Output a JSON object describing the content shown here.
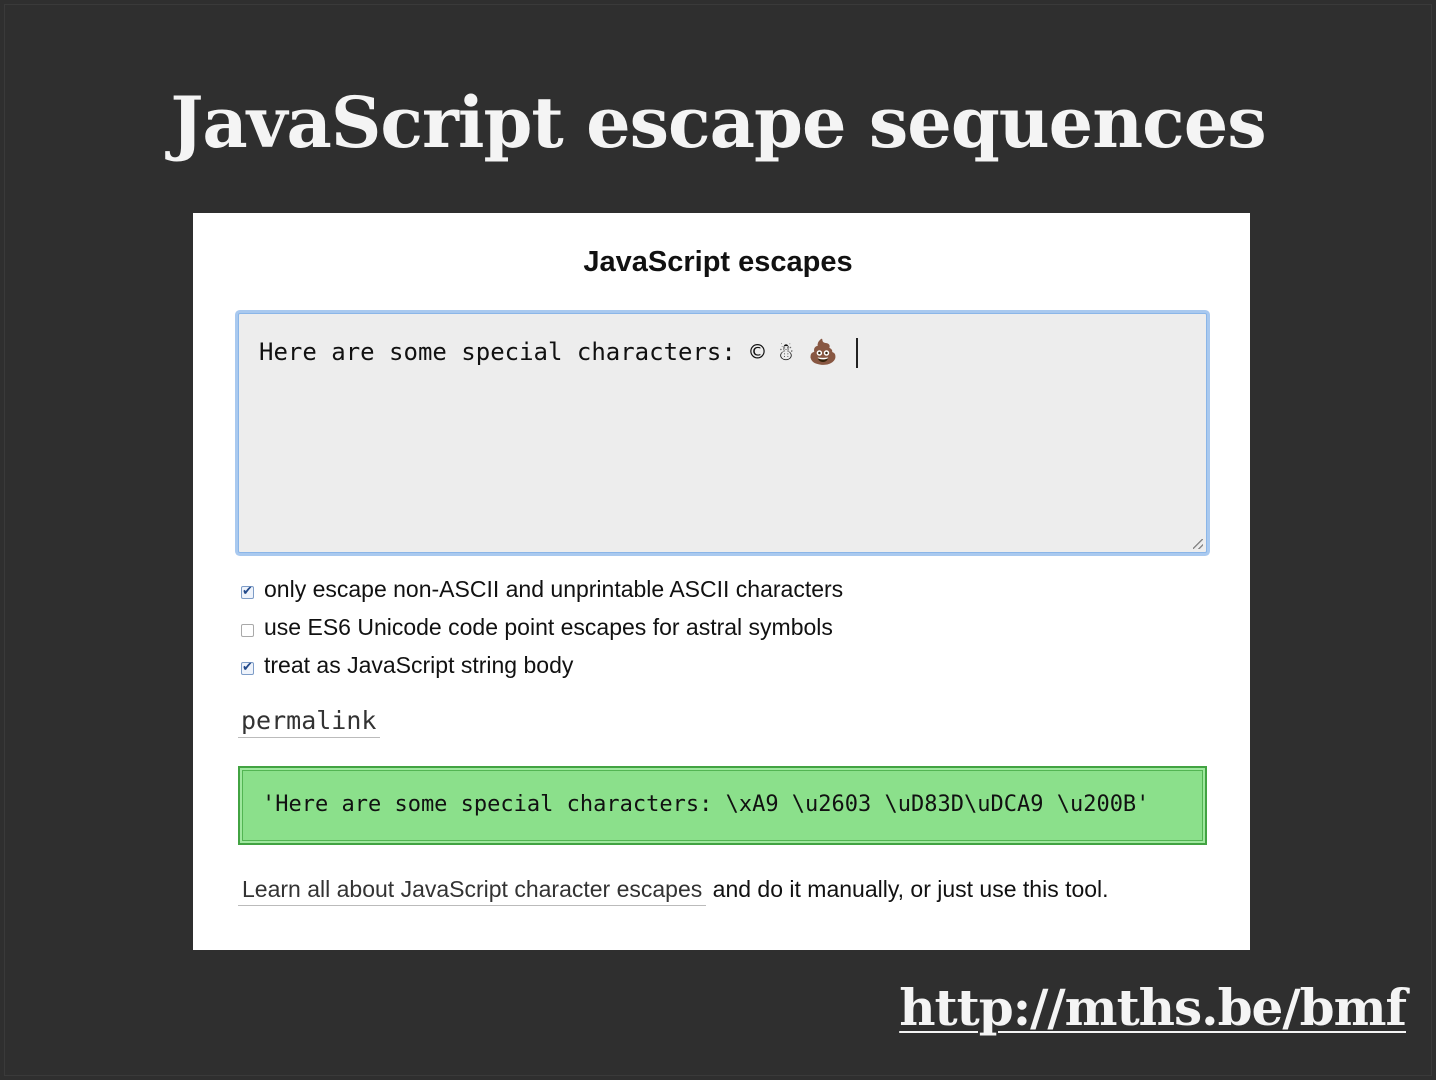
{
  "slide": {
    "title": "JavaScript escape sequences",
    "url": "http://mths.be/bmf"
  },
  "app": {
    "heading": "JavaScript escapes",
    "input": {
      "value": "Here are some special characters: © ☃ 💩 "
    },
    "options": [
      {
        "label": "only escape non-ASCII and unprintable ASCII characters",
        "checked": true
      },
      {
        "label": "use ES6 Unicode code point escapes for astral symbols",
        "checked": false
      },
      {
        "label": "treat as JavaScript string body",
        "checked": true
      }
    ],
    "permalink": "permalink",
    "output": "'Here are some special characters: \\xA9 \\u2603 \\uD83D\\uDCA9 \\u200B'",
    "footer": {
      "link": "Learn all about JavaScript character escapes",
      "text": " and do it manually, or just use this tool."
    }
  },
  "colors": {
    "slide_background": "#2f2f2f",
    "output_background": "#8be08b",
    "input_focus_ring": "#a9c9ef"
  }
}
